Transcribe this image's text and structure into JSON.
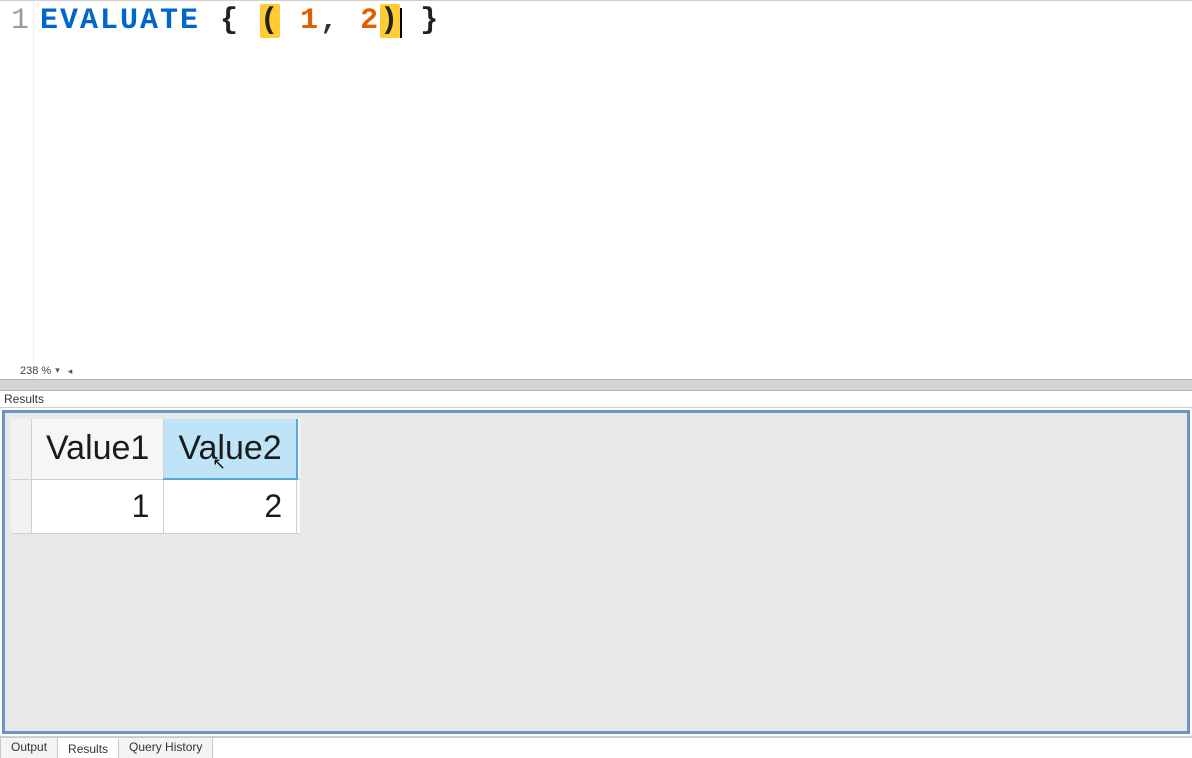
{
  "editor": {
    "line_number": "1",
    "keyword": "EVALUATE",
    "open_brace": "{",
    "open_paren": "(",
    "value1": "1",
    "comma": ",",
    "value2": "2",
    "close_paren": ")",
    "close_brace": "}",
    "zoom_text": "238 %"
  },
  "results": {
    "panel_label": "Results",
    "columns": [
      "Value1",
      "Value2"
    ],
    "rows": [
      [
        "1",
        "2"
      ]
    ],
    "hovered_column_index": 1
  },
  "tabs": {
    "items": [
      "Output",
      "Results",
      "Query History"
    ],
    "active_index": 1
  }
}
